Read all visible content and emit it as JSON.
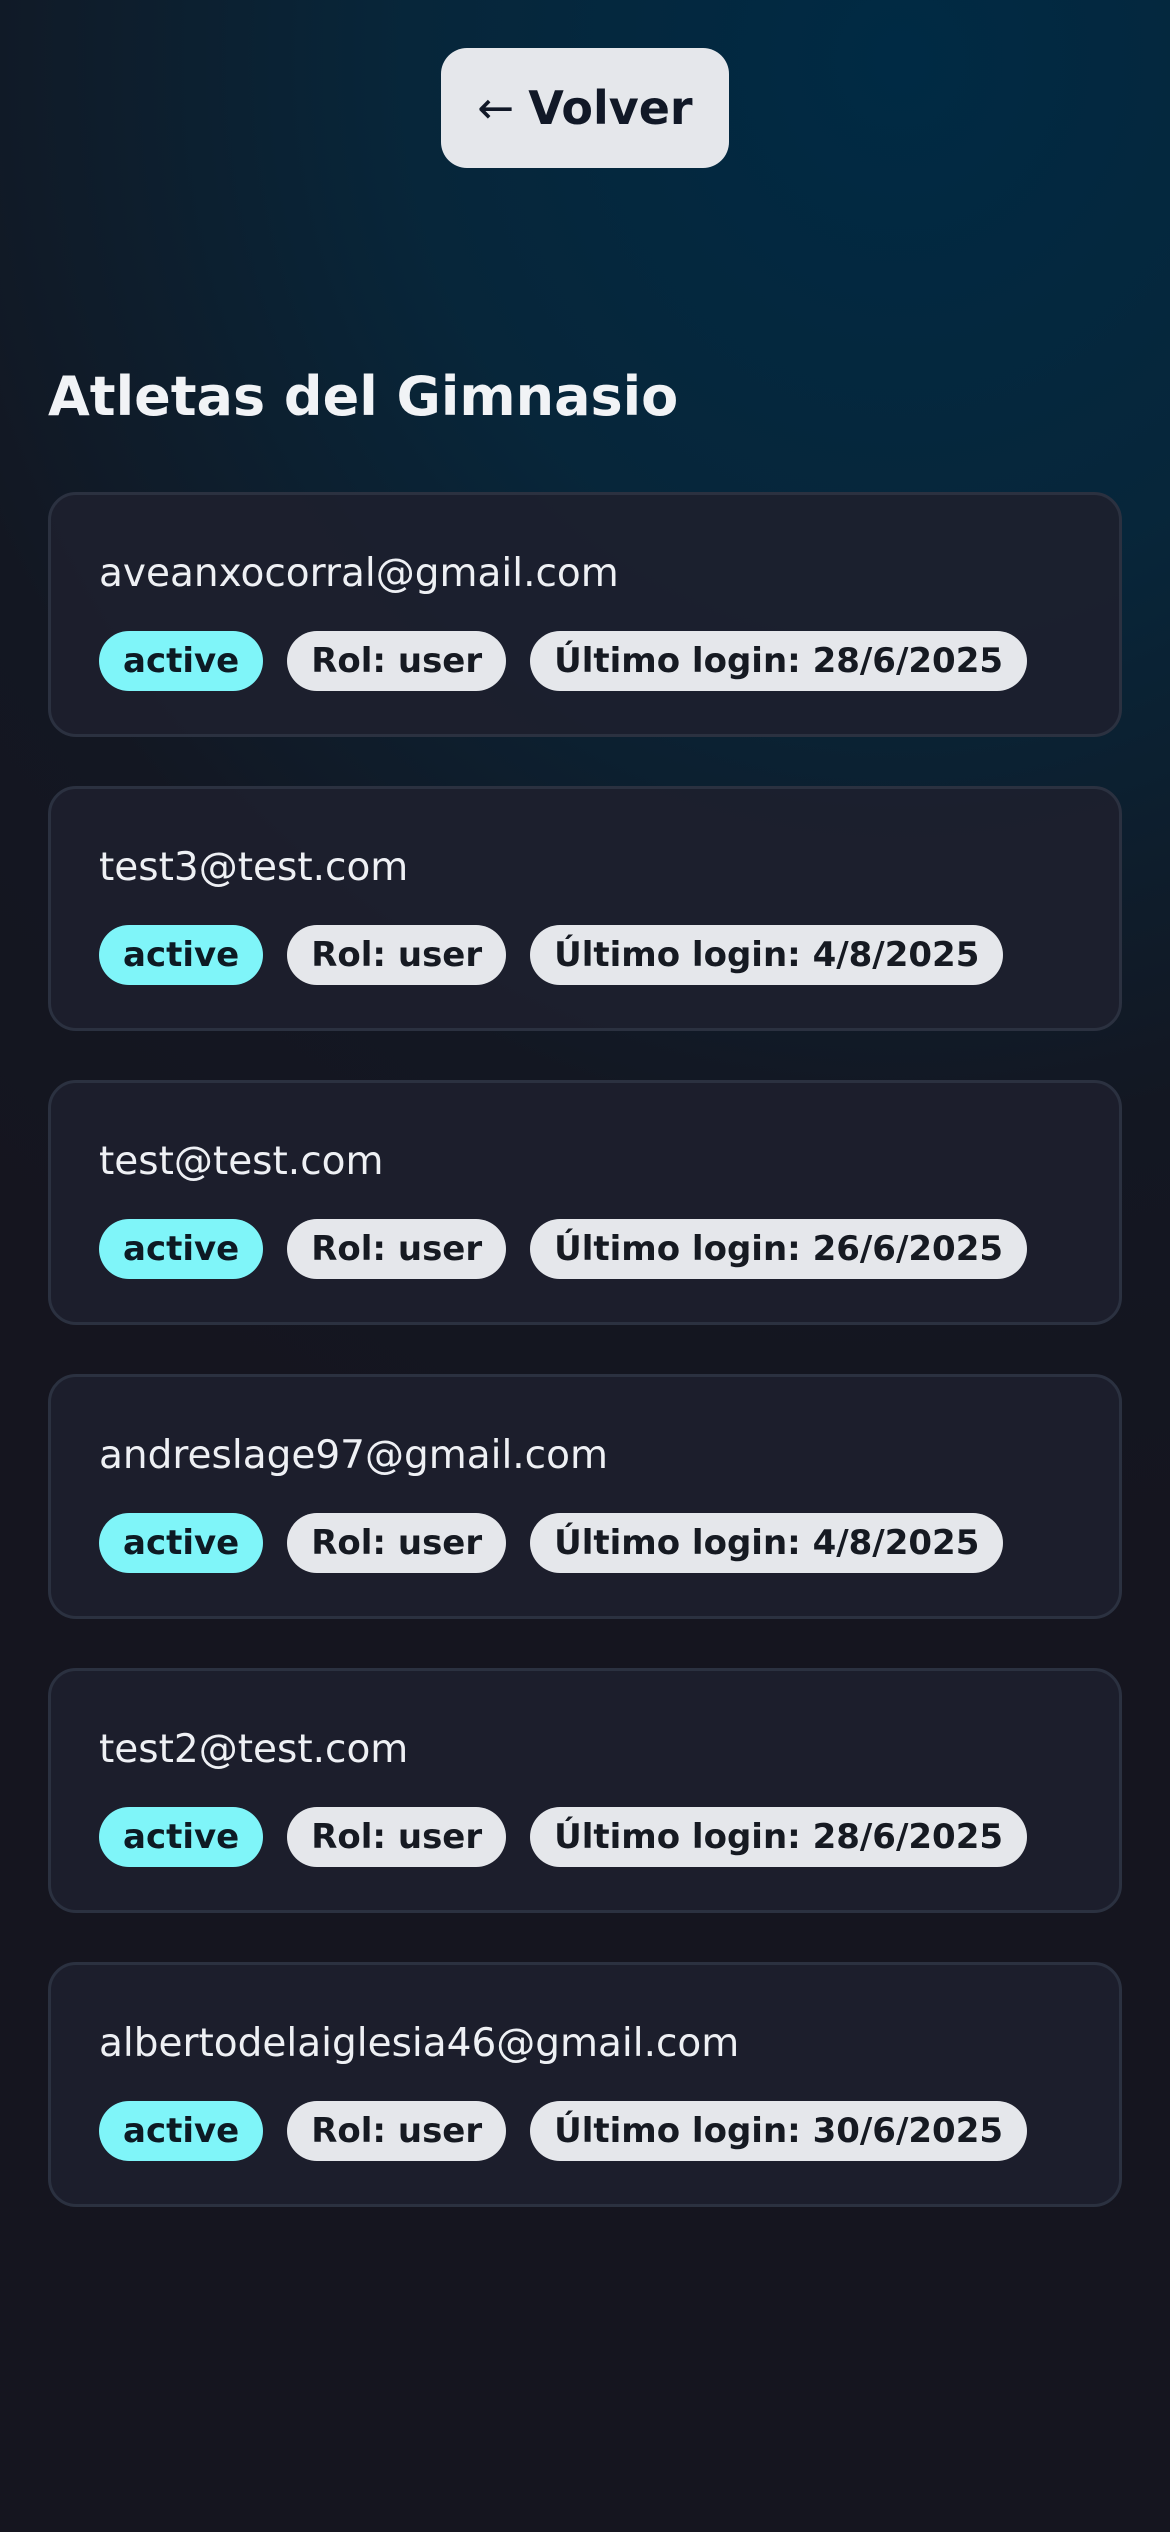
{
  "header": {
    "back_arrow": "←",
    "back_label": "Volver"
  },
  "page": {
    "title": "Atletas del Gimnasio"
  },
  "athletes": [
    {
      "email": "aveanxocorral@gmail.com",
      "status": "active",
      "role": "Rol: user",
      "last_login": "Último login: 28/6/2025"
    },
    {
      "email": "test3@test.com",
      "status": "active",
      "role": "Rol: user",
      "last_login": "Último login: 4/8/2025"
    },
    {
      "email": "test@test.com",
      "status": "active",
      "role": "Rol: user",
      "last_login": "Último login: 26/6/2025"
    },
    {
      "email": "andreslage97@gmail.com",
      "status": "active",
      "role": "Rol: user",
      "last_login": "Último login: 4/8/2025"
    },
    {
      "email": "test2@test.com",
      "status": "active",
      "role": "Rol: user",
      "last_login": "Último login: 28/6/2025"
    },
    {
      "email": "albertodelaiglesia46@gmail.com",
      "status": "active",
      "role": "Rol: user",
      "last_login": "Último login: 30/6/2025"
    }
  ],
  "colors": {
    "status_badge": "#7ff5f9",
    "neutral_badge": "#e5e7eb",
    "card_bg": "#1d202e"
  }
}
